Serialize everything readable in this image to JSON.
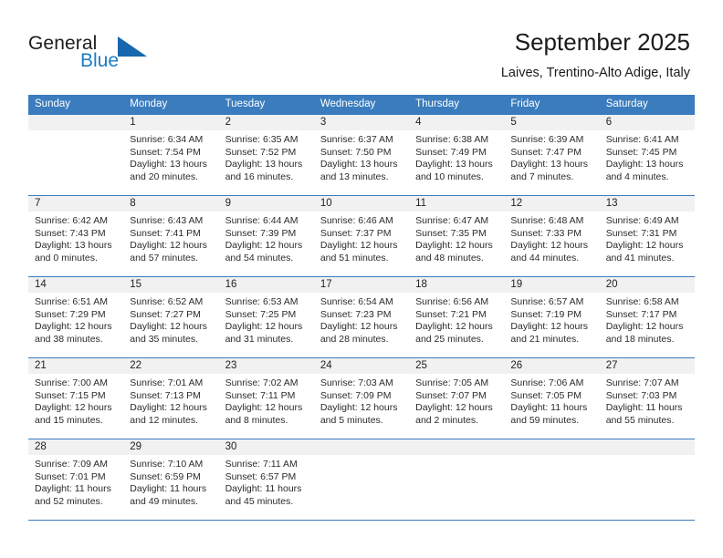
{
  "brand": {
    "name_part1": "General",
    "name_part2": "Blue",
    "accent_color": "#1667ad"
  },
  "header": {
    "title": "September 2025",
    "subtitle": "Laives, Trentino-Alto Adige, Italy"
  },
  "calendar": {
    "header_bg": "#3a7cbe",
    "weekdays": [
      "Sunday",
      "Monday",
      "Tuesday",
      "Wednesday",
      "Thursday",
      "Friday",
      "Saturday"
    ],
    "weeks": [
      [
        {
          "day": "",
          "line1": "",
          "line2": "",
          "line3": "",
          "line4": ""
        },
        {
          "day": "1",
          "line1": "Sunrise: 6:34 AM",
          "line2": "Sunset: 7:54 PM",
          "line3": "Daylight: 13 hours",
          "line4": "and 20 minutes."
        },
        {
          "day": "2",
          "line1": "Sunrise: 6:35 AM",
          "line2": "Sunset: 7:52 PM",
          "line3": "Daylight: 13 hours",
          "line4": "and 16 minutes."
        },
        {
          "day": "3",
          "line1": "Sunrise: 6:37 AM",
          "line2": "Sunset: 7:50 PM",
          "line3": "Daylight: 13 hours",
          "line4": "and 13 minutes."
        },
        {
          "day": "4",
          "line1": "Sunrise: 6:38 AM",
          "line2": "Sunset: 7:49 PM",
          "line3": "Daylight: 13 hours",
          "line4": "and 10 minutes."
        },
        {
          "day": "5",
          "line1": "Sunrise: 6:39 AM",
          "line2": "Sunset: 7:47 PM",
          "line3": "Daylight: 13 hours",
          "line4": "and 7 minutes."
        },
        {
          "day": "6",
          "line1": "Sunrise: 6:41 AM",
          "line2": "Sunset: 7:45 PM",
          "line3": "Daylight: 13 hours",
          "line4": "and 4 minutes."
        }
      ],
      [
        {
          "day": "7",
          "line1": "Sunrise: 6:42 AM",
          "line2": "Sunset: 7:43 PM",
          "line3": "Daylight: 13 hours",
          "line4": "and 0 minutes."
        },
        {
          "day": "8",
          "line1": "Sunrise: 6:43 AM",
          "line2": "Sunset: 7:41 PM",
          "line3": "Daylight: 12 hours",
          "line4": "and 57 minutes."
        },
        {
          "day": "9",
          "line1": "Sunrise: 6:44 AM",
          "line2": "Sunset: 7:39 PM",
          "line3": "Daylight: 12 hours",
          "line4": "and 54 minutes."
        },
        {
          "day": "10",
          "line1": "Sunrise: 6:46 AM",
          "line2": "Sunset: 7:37 PM",
          "line3": "Daylight: 12 hours",
          "line4": "and 51 minutes."
        },
        {
          "day": "11",
          "line1": "Sunrise: 6:47 AM",
          "line2": "Sunset: 7:35 PM",
          "line3": "Daylight: 12 hours",
          "line4": "and 48 minutes."
        },
        {
          "day": "12",
          "line1": "Sunrise: 6:48 AM",
          "line2": "Sunset: 7:33 PM",
          "line3": "Daylight: 12 hours",
          "line4": "and 44 minutes."
        },
        {
          "day": "13",
          "line1": "Sunrise: 6:49 AM",
          "line2": "Sunset: 7:31 PM",
          "line3": "Daylight: 12 hours",
          "line4": "and 41 minutes."
        }
      ],
      [
        {
          "day": "14",
          "line1": "Sunrise: 6:51 AM",
          "line2": "Sunset: 7:29 PM",
          "line3": "Daylight: 12 hours",
          "line4": "and 38 minutes."
        },
        {
          "day": "15",
          "line1": "Sunrise: 6:52 AM",
          "line2": "Sunset: 7:27 PM",
          "line3": "Daylight: 12 hours",
          "line4": "and 35 minutes."
        },
        {
          "day": "16",
          "line1": "Sunrise: 6:53 AM",
          "line2": "Sunset: 7:25 PM",
          "line3": "Daylight: 12 hours",
          "line4": "and 31 minutes."
        },
        {
          "day": "17",
          "line1": "Sunrise: 6:54 AM",
          "line2": "Sunset: 7:23 PM",
          "line3": "Daylight: 12 hours",
          "line4": "and 28 minutes."
        },
        {
          "day": "18",
          "line1": "Sunrise: 6:56 AM",
          "line2": "Sunset: 7:21 PM",
          "line3": "Daylight: 12 hours",
          "line4": "and 25 minutes."
        },
        {
          "day": "19",
          "line1": "Sunrise: 6:57 AM",
          "line2": "Sunset: 7:19 PM",
          "line3": "Daylight: 12 hours",
          "line4": "and 21 minutes."
        },
        {
          "day": "20",
          "line1": "Sunrise: 6:58 AM",
          "line2": "Sunset: 7:17 PM",
          "line3": "Daylight: 12 hours",
          "line4": "and 18 minutes."
        }
      ],
      [
        {
          "day": "21",
          "line1": "Sunrise: 7:00 AM",
          "line2": "Sunset: 7:15 PM",
          "line3": "Daylight: 12 hours",
          "line4": "and 15 minutes."
        },
        {
          "day": "22",
          "line1": "Sunrise: 7:01 AM",
          "line2": "Sunset: 7:13 PM",
          "line3": "Daylight: 12 hours",
          "line4": "and 12 minutes."
        },
        {
          "day": "23",
          "line1": "Sunrise: 7:02 AM",
          "line2": "Sunset: 7:11 PM",
          "line3": "Daylight: 12 hours",
          "line4": "and 8 minutes."
        },
        {
          "day": "24",
          "line1": "Sunrise: 7:03 AM",
          "line2": "Sunset: 7:09 PM",
          "line3": "Daylight: 12 hours",
          "line4": "and 5 minutes."
        },
        {
          "day": "25",
          "line1": "Sunrise: 7:05 AM",
          "line2": "Sunset: 7:07 PM",
          "line3": "Daylight: 12 hours",
          "line4": "and 2 minutes."
        },
        {
          "day": "26",
          "line1": "Sunrise: 7:06 AM",
          "line2": "Sunset: 7:05 PM",
          "line3": "Daylight: 11 hours",
          "line4": "and 59 minutes."
        },
        {
          "day": "27",
          "line1": "Sunrise: 7:07 AM",
          "line2": "Sunset: 7:03 PM",
          "line3": "Daylight: 11 hours",
          "line4": "and 55 minutes."
        }
      ],
      [
        {
          "day": "28",
          "line1": "Sunrise: 7:09 AM",
          "line2": "Sunset: 7:01 PM",
          "line3": "Daylight: 11 hours",
          "line4": "and 52 minutes."
        },
        {
          "day": "29",
          "line1": "Sunrise: 7:10 AM",
          "line2": "Sunset: 6:59 PM",
          "line3": "Daylight: 11 hours",
          "line4": "and 49 minutes."
        },
        {
          "day": "30",
          "line1": "Sunrise: 7:11 AM",
          "line2": "Sunset: 6:57 PM",
          "line3": "Daylight: 11 hours",
          "line4": "and 45 minutes."
        },
        {
          "day": "",
          "line1": "",
          "line2": "",
          "line3": "",
          "line4": ""
        },
        {
          "day": "",
          "line1": "",
          "line2": "",
          "line3": "",
          "line4": ""
        },
        {
          "day": "",
          "line1": "",
          "line2": "",
          "line3": "",
          "line4": ""
        },
        {
          "day": "",
          "line1": "",
          "line2": "",
          "line3": "",
          "line4": ""
        }
      ]
    ]
  }
}
